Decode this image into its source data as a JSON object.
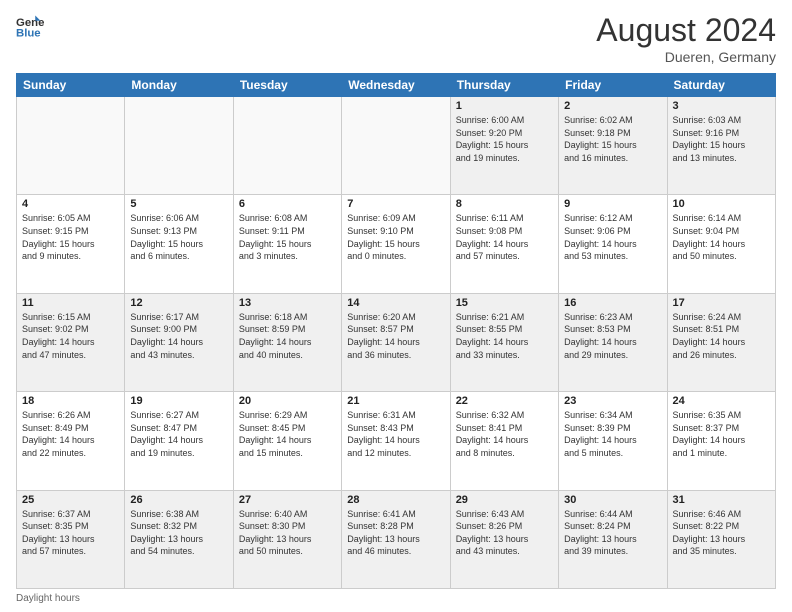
{
  "header": {
    "logo_line1": "General",
    "logo_line2": "Blue",
    "month": "August 2024",
    "location": "Dueren, Germany"
  },
  "weekdays": [
    "Sunday",
    "Monday",
    "Tuesday",
    "Wednesday",
    "Thursday",
    "Friday",
    "Saturday"
  ],
  "weeks": [
    [
      {
        "day": "",
        "info": ""
      },
      {
        "day": "",
        "info": ""
      },
      {
        "day": "",
        "info": ""
      },
      {
        "day": "",
        "info": ""
      },
      {
        "day": "1",
        "info": "Sunrise: 6:00 AM\nSunset: 9:20 PM\nDaylight: 15 hours\nand 19 minutes."
      },
      {
        "day": "2",
        "info": "Sunrise: 6:02 AM\nSunset: 9:18 PM\nDaylight: 15 hours\nand 16 minutes."
      },
      {
        "day": "3",
        "info": "Sunrise: 6:03 AM\nSunset: 9:16 PM\nDaylight: 15 hours\nand 13 minutes."
      }
    ],
    [
      {
        "day": "4",
        "info": "Sunrise: 6:05 AM\nSunset: 9:15 PM\nDaylight: 15 hours\nand 9 minutes."
      },
      {
        "day": "5",
        "info": "Sunrise: 6:06 AM\nSunset: 9:13 PM\nDaylight: 15 hours\nand 6 minutes."
      },
      {
        "day": "6",
        "info": "Sunrise: 6:08 AM\nSunset: 9:11 PM\nDaylight: 15 hours\nand 3 minutes."
      },
      {
        "day": "7",
        "info": "Sunrise: 6:09 AM\nSunset: 9:10 PM\nDaylight: 15 hours\nand 0 minutes."
      },
      {
        "day": "8",
        "info": "Sunrise: 6:11 AM\nSunset: 9:08 PM\nDaylight: 14 hours\nand 57 minutes."
      },
      {
        "day": "9",
        "info": "Sunrise: 6:12 AM\nSunset: 9:06 PM\nDaylight: 14 hours\nand 53 minutes."
      },
      {
        "day": "10",
        "info": "Sunrise: 6:14 AM\nSunset: 9:04 PM\nDaylight: 14 hours\nand 50 minutes."
      }
    ],
    [
      {
        "day": "11",
        "info": "Sunrise: 6:15 AM\nSunset: 9:02 PM\nDaylight: 14 hours\nand 47 minutes."
      },
      {
        "day": "12",
        "info": "Sunrise: 6:17 AM\nSunset: 9:00 PM\nDaylight: 14 hours\nand 43 minutes."
      },
      {
        "day": "13",
        "info": "Sunrise: 6:18 AM\nSunset: 8:59 PM\nDaylight: 14 hours\nand 40 minutes."
      },
      {
        "day": "14",
        "info": "Sunrise: 6:20 AM\nSunset: 8:57 PM\nDaylight: 14 hours\nand 36 minutes."
      },
      {
        "day": "15",
        "info": "Sunrise: 6:21 AM\nSunset: 8:55 PM\nDaylight: 14 hours\nand 33 minutes."
      },
      {
        "day": "16",
        "info": "Sunrise: 6:23 AM\nSunset: 8:53 PM\nDaylight: 14 hours\nand 29 minutes."
      },
      {
        "day": "17",
        "info": "Sunrise: 6:24 AM\nSunset: 8:51 PM\nDaylight: 14 hours\nand 26 minutes."
      }
    ],
    [
      {
        "day": "18",
        "info": "Sunrise: 6:26 AM\nSunset: 8:49 PM\nDaylight: 14 hours\nand 22 minutes."
      },
      {
        "day": "19",
        "info": "Sunrise: 6:27 AM\nSunset: 8:47 PM\nDaylight: 14 hours\nand 19 minutes."
      },
      {
        "day": "20",
        "info": "Sunrise: 6:29 AM\nSunset: 8:45 PM\nDaylight: 14 hours\nand 15 minutes."
      },
      {
        "day": "21",
        "info": "Sunrise: 6:31 AM\nSunset: 8:43 PM\nDaylight: 14 hours\nand 12 minutes."
      },
      {
        "day": "22",
        "info": "Sunrise: 6:32 AM\nSunset: 8:41 PM\nDaylight: 14 hours\nand 8 minutes."
      },
      {
        "day": "23",
        "info": "Sunrise: 6:34 AM\nSunset: 8:39 PM\nDaylight: 14 hours\nand 5 minutes."
      },
      {
        "day": "24",
        "info": "Sunrise: 6:35 AM\nSunset: 8:37 PM\nDaylight: 14 hours\nand 1 minute."
      }
    ],
    [
      {
        "day": "25",
        "info": "Sunrise: 6:37 AM\nSunset: 8:35 PM\nDaylight: 13 hours\nand 57 minutes."
      },
      {
        "day": "26",
        "info": "Sunrise: 6:38 AM\nSunset: 8:32 PM\nDaylight: 13 hours\nand 54 minutes."
      },
      {
        "day": "27",
        "info": "Sunrise: 6:40 AM\nSunset: 8:30 PM\nDaylight: 13 hours\nand 50 minutes."
      },
      {
        "day": "28",
        "info": "Sunrise: 6:41 AM\nSunset: 8:28 PM\nDaylight: 13 hours\nand 46 minutes."
      },
      {
        "day": "29",
        "info": "Sunrise: 6:43 AM\nSunset: 8:26 PM\nDaylight: 13 hours\nand 43 minutes."
      },
      {
        "day": "30",
        "info": "Sunrise: 6:44 AM\nSunset: 8:24 PM\nDaylight: 13 hours\nand 39 minutes."
      },
      {
        "day": "31",
        "info": "Sunrise: 6:46 AM\nSunset: 8:22 PM\nDaylight: 13 hours\nand 35 minutes."
      }
    ]
  ],
  "footer": "Daylight hours"
}
